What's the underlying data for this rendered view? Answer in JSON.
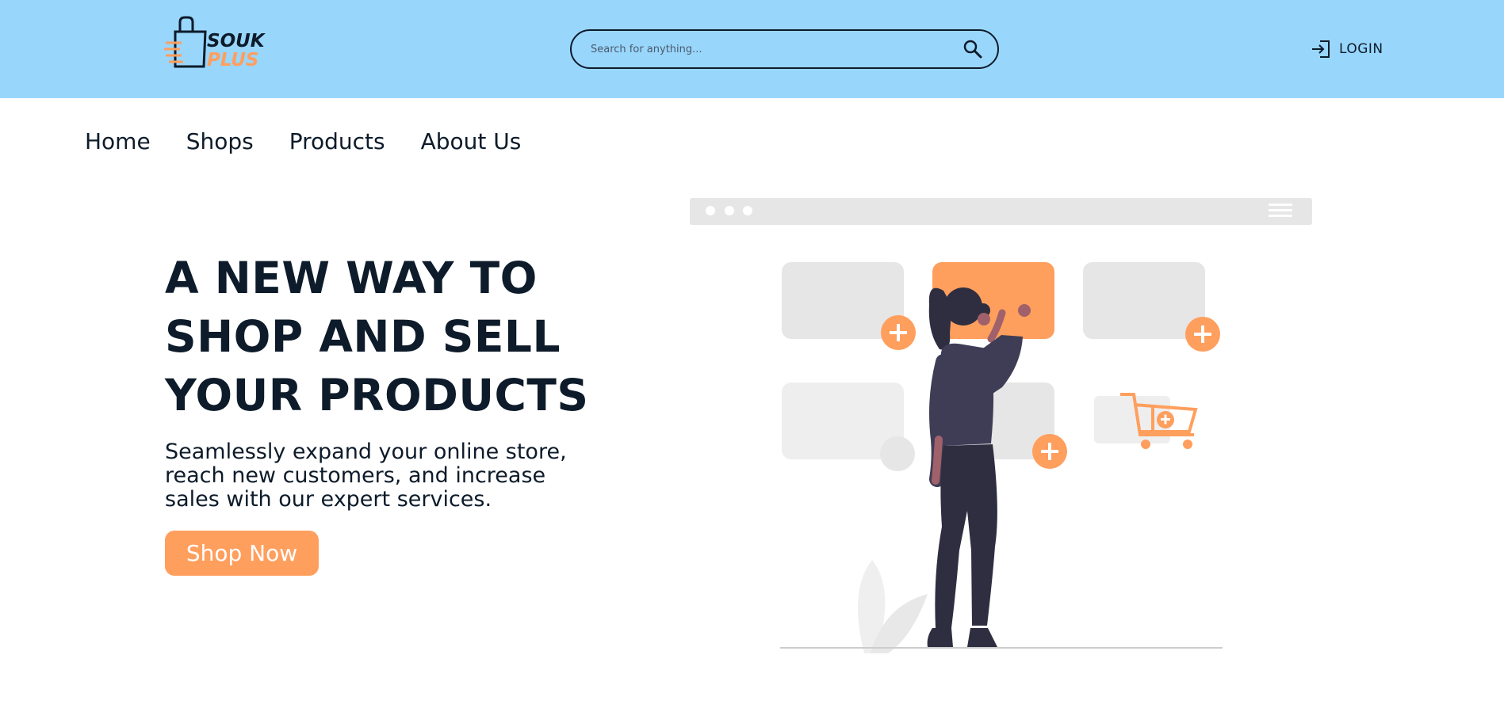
{
  "header": {
    "logo_line1": "SOUK",
    "logo_line2": "PLUS",
    "search_placeholder": "Search for anything...",
    "search_icon": "search-icon",
    "login_icon": "login-icon",
    "login_label": "LOGIN"
  },
  "nav": {
    "items": [
      {
        "label": "Home"
      },
      {
        "label": "Shops"
      },
      {
        "label": "Products"
      },
      {
        "label": "About Us"
      }
    ]
  },
  "hero": {
    "title_lines": [
      "A NEW WAY TO",
      "SHOP AND SELL",
      "YOUR PRODUCTS"
    ],
    "subtitle_lines": [
      "Seamlessly expand your online store,",
      "reach new customers, and increase",
      "sales with our expert services."
    ],
    "cta_label": "Shop Now"
  },
  "colors": {
    "header_bg": "#99d6fc",
    "accent": "#ff9f5e",
    "text_dark": "#0d1b2a"
  }
}
